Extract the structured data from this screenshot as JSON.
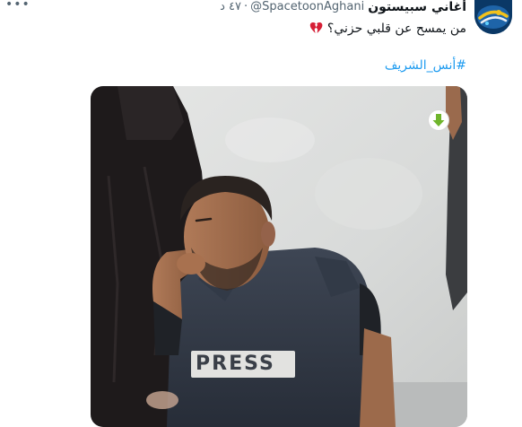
{
  "tweet": {
    "display_name": "أغاني سبيستون",
    "handle": "@SpacetoonAghani",
    "separator": "·",
    "timestamp": "٤٧ د",
    "text": "من يمسح عن قلبي حزني؟",
    "emoji_icon": "broken-heart-icon",
    "hashtag": "#أنس_الشريف"
  },
  "media": {
    "vest_label": "PRESS",
    "download_icon": "download-arrow-icon"
  },
  "colors": {
    "link": "#1d9bf0",
    "text": "#0f1419",
    "secondary": "#536471",
    "download_green": "#6fb52c"
  }
}
